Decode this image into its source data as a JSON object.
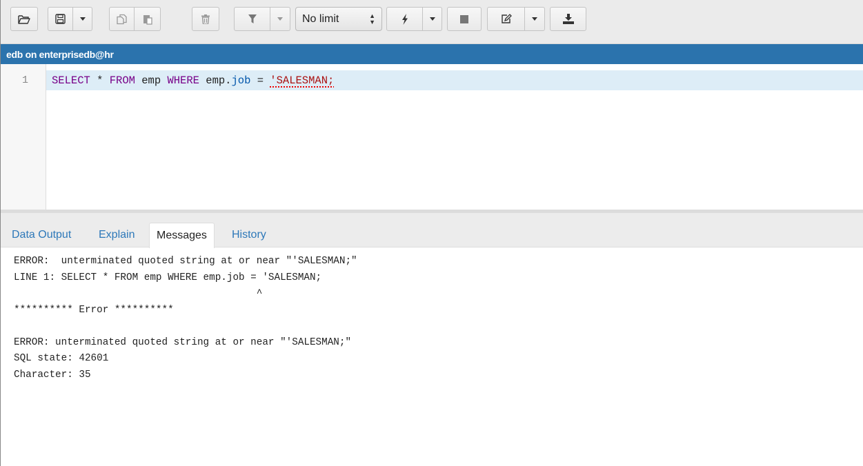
{
  "toolbar": {
    "limit_value": "No limit",
    "limit_spin": "▲▼"
  },
  "connection": {
    "title": "edb on enterprisedb@hr"
  },
  "editor": {
    "line_number": "1",
    "tokens": {
      "kw_select": "SELECT",
      "star": " * ",
      "kw_from": "FROM",
      "table": " emp ",
      "kw_where": "WHERE",
      "emp_dot": " emp.",
      "column": "job",
      "equals": " = ",
      "string": "'SALESMAN;"
    }
  },
  "tabs": [
    {
      "label": "Data Output"
    },
    {
      "label": "Explain"
    },
    {
      "label": "Messages"
    },
    {
      "label": "History"
    }
  ],
  "messages": [
    "ERROR:  unterminated quoted string at or near \"'SALESMAN;\"",
    "LINE 1: SELECT * FROM emp WHERE emp.job = 'SALESMAN;",
    "                                         ^",
    "********** Error **********",
    "",
    "ERROR: unterminated quoted string at or near \"'SALESMAN;\"",
    "SQL state: 42601",
    "Character: 35"
  ],
  "colors": {
    "title_bar": "#2b73ad",
    "active_line": "#ddedf7",
    "tab_link": "#2d78b9"
  }
}
